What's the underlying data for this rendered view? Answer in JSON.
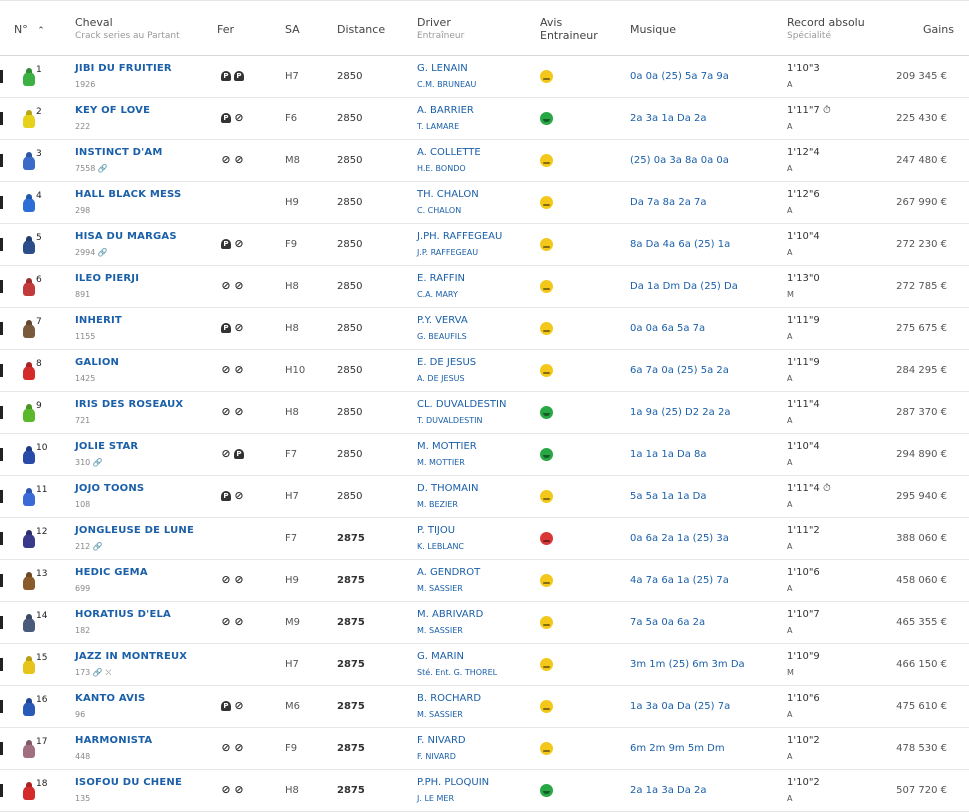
{
  "header": {
    "num": "N°",
    "sort_icon": "chevron-up-icon",
    "cheval": "Cheval",
    "cheval_sub": "Crack series au Partant",
    "fer": "Fer",
    "sa": "SA",
    "distance": "Distance",
    "driver": "Driver",
    "driver_sub": "Entraîneur",
    "avis1": "Avis",
    "avis2": "Entraineur",
    "musique": "Musique",
    "record": "Record absolu",
    "record_sub": "Spécialité",
    "gains": "Gains"
  },
  "colors": {
    "link": "#1a5fa8",
    "good": "#28a745",
    "neutral": "#f3c81a",
    "bad": "#d93636"
  },
  "rows": [
    {
      "n": "1",
      "name": "JIBI DU FRUITIER",
      "sub": "1926",
      "shoes": [
        "d",
        "d"
      ],
      "sa": "H7",
      "dist": "2850",
      "bold": false,
      "driver": "G. LENAIN",
      "trainer": "C.M. BRUNEAU",
      "avis": "y",
      "music": "0a 0a (25) 5a 7a 9a",
      "rec": "1'10\"3",
      "spec": "A",
      "gains": "209 345 €",
      "col": "#3cb043"
    },
    {
      "n": "2",
      "name": "KEY OF LOVE",
      "sub": "222",
      "shoes": [
        "d",
        "s"
      ],
      "sa": "F6",
      "dist": "2850",
      "bold": false,
      "driver": "A. BARRIER",
      "trainer": "T. LAMARE",
      "avis": "g",
      "music": "2a 3a 1a Da 2a",
      "rec": "1'11\"7 ⏱",
      "spec": "A",
      "gains": "225 430 €",
      "col": "#e6d21a"
    },
    {
      "n": "3",
      "name": "INSTINCT D'AM",
      "sub": "7558 🔗",
      "shoes": [
        "s",
        "s"
      ],
      "sa": "M8",
      "dist": "2850",
      "bold": false,
      "driver": "A. COLLETTE",
      "trainer": "H.E. BONDO",
      "avis": "y",
      "music": "(25) 0a 3a 8a 0a 0a",
      "rec": "1'12\"4",
      "spec": "A",
      "gains": "247 480 €",
      "col": "#3a6bc8"
    },
    {
      "n": "4",
      "name": "HALL BLACK MESS",
      "sub": "298",
      "shoes": [],
      "sa": "H9",
      "dist": "2850",
      "bold": false,
      "driver": "TH. CHALON",
      "trainer": "C. CHALON",
      "avis": "y",
      "music": "Da 7a 8a 2a 7a",
      "rec": "1'12\"6",
      "spec": "A",
      "gains": "267 990 €",
      "col": "#2b6fd6"
    },
    {
      "n": "5",
      "name": "HISA DU MARGAS",
      "sub": "2994 🔗",
      "shoes": [
        "d",
        "s"
      ],
      "sa": "F9",
      "dist": "2850",
      "bold": false,
      "driver": "J.PH. RAFFEGEAU",
      "trainer": "J.P. RAFFEGEAU",
      "avis": "y",
      "music": "8a Da 4a 6a (25) 1a",
      "rec": "1'10\"4",
      "spec": "A",
      "gains": "272 230 €",
      "col": "#2b4d8a"
    },
    {
      "n": "6",
      "name": "ILEO PIERJI",
      "sub": "891",
      "shoes": [
        "s",
        "s"
      ],
      "sa": "H8",
      "dist": "2850",
      "bold": false,
      "driver": "E. RAFFIN",
      "trainer": "C.A. MARY",
      "avis": "y",
      "music": "Da 1a Dm Da (25) Da",
      "rec": "1'13\"0",
      "spec": "M",
      "gains": "272 785 €",
      "col": "#c23a3a"
    },
    {
      "n": "7",
      "name": "INHERIT",
      "sub": "1155",
      "shoes": [
        "d",
        "s"
      ],
      "sa": "H8",
      "dist": "2850",
      "bold": false,
      "driver": "P.Y. VERVA",
      "trainer": "G. BEAUFILS",
      "avis": "y",
      "music": "0a 0a 6a 5a 7a",
      "rec": "1'11\"9",
      "spec": "A",
      "gains": "275 675 €",
      "col": "#7a5a3a"
    },
    {
      "n": "8",
      "name": "GALION",
      "sub": "1425",
      "shoes": [
        "s",
        "s"
      ],
      "sa": "H10",
      "dist": "2850",
      "bold": false,
      "driver": "E. DE JESUS",
      "trainer": "A. DE JESUS",
      "avis": "y",
      "music": "6a 7a 0a (25) 5a 2a",
      "rec": "1'11\"9",
      "spec": "A",
      "gains": "284 295 €",
      "col": "#d42a2a"
    },
    {
      "n": "9",
      "name": "IRIS DES ROSEAUX",
      "sub": "721",
      "shoes": [
        "s",
        "s"
      ],
      "sa": "H8",
      "dist": "2850",
      "bold": false,
      "driver": "CL. DUVALDESTIN",
      "trainer": "T. DUVALDESTIN",
      "avis": "g",
      "music": "1a 9a (25) D2 2a 2a",
      "rec": "1'11\"4",
      "spec": "A",
      "gains": "287 370 €",
      "col": "#5ab82a"
    },
    {
      "n": "10",
      "name": "JOLIE STAR",
      "sub": "310 🔗",
      "shoes": [
        "s",
        "d"
      ],
      "sa": "F7",
      "dist": "2850",
      "bold": false,
      "driver": "M. MOTTIER",
      "trainer": "M. MOTTIER",
      "avis": "g",
      "music": "1a 1a 1a Da 8a",
      "rec": "1'10\"4",
      "spec": "A",
      "gains": "294 890 €",
      "col": "#2a4aa8"
    },
    {
      "n": "11",
      "name": "JOJO TOONS",
      "sub": "108",
      "shoes": [
        "d",
        "s"
      ],
      "sa": "H7",
      "dist": "2850",
      "bold": false,
      "driver": "D. THOMAIN",
      "trainer": "M. BEZIER",
      "avis": "y",
      "music": "5a 5a 1a 1a Da",
      "rec": "1'11\"4 ⏱",
      "spec": "A",
      "gains": "295 940 €",
      "col": "#3a6ad8"
    },
    {
      "n": "12",
      "name": "JONGLEUSE DE LUNE",
      "sub": "212 🔗",
      "shoes": [],
      "sa": "F7",
      "dist": "2875",
      "bold": true,
      "driver": "P. TIJOU",
      "trainer": "K. LEBLANC",
      "avis": "r",
      "music": "0a 6a 2a 1a (25) 3a",
      "rec": "1'11\"2",
      "spec": "A",
      "gains": "388 060 €",
      "col": "#3a3a8a"
    },
    {
      "n": "13",
      "name": "HEDIC GEMA",
      "sub": "699",
      "shoes": [
        "s",
        "s"
      ],
      "sa": "H9",
      "dist": "2875",
      "bold": true,
      "driver": "A. GENDROT",
      "trainer": "M. SASSIER",
      "avis": "y",
      "music": "4a 7a 6a 1a (25) 7a",
      "rec": "1'10\"6",
      "spec": "A",
      "gains": "458 060 €",
      "col": "#8a5a2a"
    },
    {
      "n": "14",
      "name": "HORATIUS D'ELA",
      "sub": "182",
      "shoes": [
        "s",
        "s"
      ],
      "sa": "M9",
      "dist": "2875",
      "bold": true,
      "driver": "M. ABRIVARD",
      "trainer": "M. SASSIER",
      "avis": "y",
      "music": "7a 5a 0a 6a 2a",
      "rec": "1'10\"7",
      "spec": "A",
      "gains": "465 355 €",
      "col": "#4a5a7a"
    },
    {
      "n": "15",
      "name": "JAZZ IN MONTREUX",
      "sub": "173 🔗 ⛌",
      "shoes": [],
      "sa": "H7",
      "dist": "2875",
      "bold": true,
      "driver": "G. MARIN",
      "trainer": "Sté. Ent. G. THOREL",
      "avis": "y",
      "music": "3m 1m (25) 6m 3m Da",
      "rec": "1'10\"9",
      "spec": "M",
      "gains": "466 150 €",
      "col": "#e6c41a"
    },
    {
      "n": "16",
      "name": "KANTO AVIS",
      "sub": "96",
      "shoes": [
        "d",
        "s"
      ],
      "sa": "M6",
      "dist": "2875",
      "bold": true,
      "driver": "B. ROCHARD",
      "trainer": "M. SASSIER",
      "avis": "y",
      "music": "1a 3a 0a Da (25) 7a",
      "rec": "1'10\"6",
      "spec": "A",
      "gains": "475 610 €",
      "col": "#2a5ab8"
    },
    {
      "n": "17",
      "name": "HARMONISTA",
      "sub": "448",
      "shoes": [
        "s",
        "s"
      ],
      "sa": "F9",
      "dist": "2875",
      "bold": true,
      "driver": "F. NIVARD",
      "trainer": "F. NIVARD",
      "avis": "y",
      "music": "6m 2m 9m 5m Dm",
      "rec": "1'10\"2",
      "spec": "A",
      "gains": "478 530 €",
      "col": "#a07080"
    },
    {
      "n": "18",
      "name": "ISOFOU DU CHENE",
      "sub": "135",
      "shoes": [
        "s",
        "s"
      ],
      "sa": "H8",
      "dist": "2875",
      "bold": true,
      "driver": "P.PH. PLOQUIN",
      "trainer": "J. LE MER",
      "avis": "g",
      "music": "2a 1a 3a Da 2a",
      "rec": "1'10\"2",
      "spec": "A",
      "gains": "507 720 €",
      "col": "#d42a2a"
    }
  ]
}
